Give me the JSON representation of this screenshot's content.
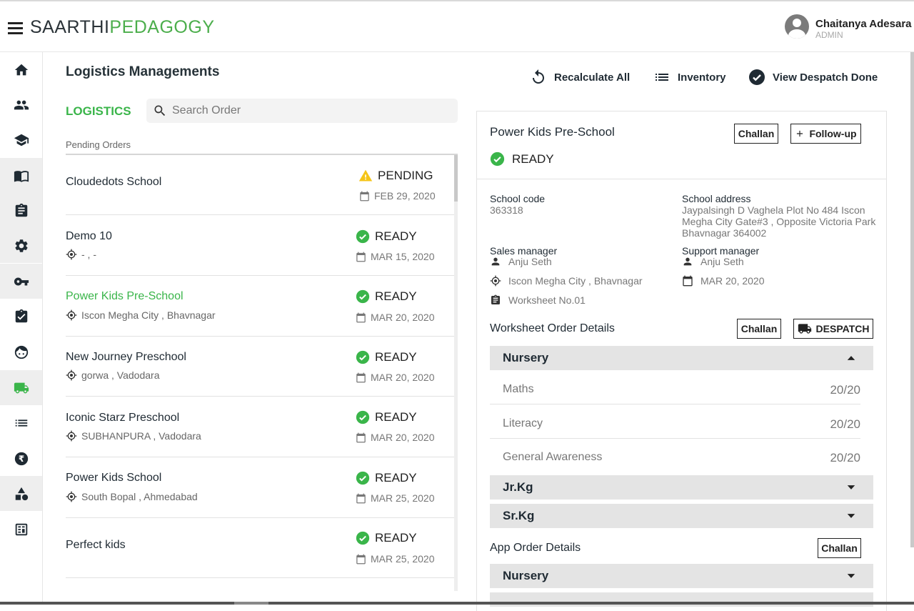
{
  "header": {
    "brand_part1": "SAARTHI",
    "brand_part2": "PEDAGOGY",
    "user_name": "Chaitanya Adesara",
    "user_role": "ADMIN"
  },
  "sidebar": {
    "items": [
      {
        "icon": "home-icon"
      },
      {
        "icon": "people-icon"
      },
      {
        "icon": "school-icon"
      },
      {
        "icon": "book-icon"
      },
      {
        "icon": "clipboard-icon"
      },
      {
        "icon": "gear-icon"
      },
      {
        "icon": "key-icon"
      },
      {
        "icon": "assignment-check-icon"
      },
      {
        "icon": "face-icon"
      },
      {
        "icon": "truck-icon",
        "active": true
      },
      {
        "icon": "list-icon"
      },
      {
        "icon": "rupee-icon"
      },
      {
        "icon": "shapes-icon"
      },
      {
        "icon": "calculator-icon"
      }
    ],
    "active_color": "#3ab54a"
  },
  "main": {
    "title": "Logistics Managements",
    "actions": {
      "recalculate": "Recalculate All",
      "inventory": "Inventory",
      "view_despatch": "View Despatch Done"
    },
    "logistics_label": "LOGISTICS",
    "search_placeholder": "Search Order",
    "pending_label": "Pending Orders"
  },
  "orders": [
    {
      "name": "Cloudedots School",
      "location": "",
      "status": "PENDING",
      "date": "FEB 29, 2020"
    },
    {
      "name": "Demo 10",
      "location": "- , -",
      "status": "READY",
      "date": "MAR 15, 2020"
    },
    {
      "name": "Power Kids Pre-School",
      "location": "Iscon Megha City , Bhavnagar",
      "status": "READY",
      "date": "MAR 20, 2020",
      "active": true
    },
    {
      "name": "New Journey Preschool",
      "location": "gorwa , Vadodara",
      "status": "READY",
      "date": "MAR 20, 2020"
    },
    {
      "name": "Iconic Starz Preschool",
      "location": "SUBHANPURA , Vadodara",
      "status": "READY",
      "date": "MAR 20, 2020"
    },
    {
      "name": "Power Kids School",
      "location": "South Bopal , Ahmedabad",
      "status": "READY",
      "date": "MAR 25, 2020"
    },
    {
      "name": "Perfect kids",
      "location": "",
      "status": "READY",
      "date": "MAR 25, 2020"
    }
  ],
  "detail": {
    "school_name": "Power Kids Pre-School",
    "status": "READY",
    "challan_label": "Challan",
    "followup_label": "Follow-up",
    "school_code_label": "School code",
    "school_code": "363318",
    "school_address_label": "School address",
    "school_address": "Jaypalsingh D Vaghela Plot No 484 Iscon Megha City Gate#3 , Opposite Victoria Park Bhavnagar 364002",
    "sales_manager_label": "Sales manager",
    "sales_manager": "Anju Seth",
    "location": "Iscon Megha City , Bhavnagar",
    "worksheet_no": "Worksheet No.01",
    "support_manager_label": "Support manager",
    "support_manager": "Anju Seth",
    "date": "MAR 20, 2020",
    "worksheet_section": "Worksheet Order Details",
    "worksheet_challan": "Challan",
    "despatch_label": "DESPATCH",
    "worksheet_grades": [
      {
        "name": "Nursery",
        "expanded": true,
        "subjects": [
          {
            "name": "Maths",
            "value": "20/20"
          },
          {
            "name": "Literacy",
            "value": "20/20"
          },
          {
            "name": "General Awareness",
            "value": "20/20"
          }
        ]
      },
      {
        "name": "Jr.Kg",
        "expanded": false
      },
      {
        "name": "Sr.Kg",
        "expanded": false
      }
    ],
    "app_section": "App Order Details",
    "app_challan": "Challan",
    "app_grades": [
      {
        "name": "Nursery",
        "expanded": false
      }
    ]
  },
  "colors": {
    "accent": "#3ab54a",
    "pending": "#f5c518",
    "ready": "#3ab54a"
  }
}
